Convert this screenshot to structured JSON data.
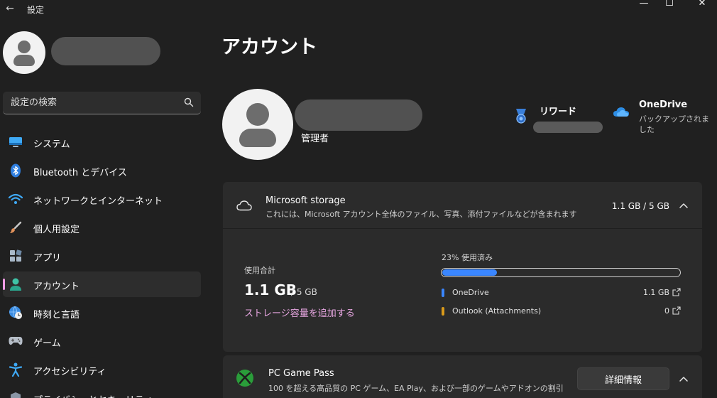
{
  "window": {
    "back_glyph": "←",
    "title": "設定",
    "min_glyph": "—",
    "max_glyph": "☐",
    "close_glyph": "✕"
  },
  "search": {
    "placeholder": "設定の検索"
  },
  "sidebar": {
    "items": [
      {
        "label": "システム",
        "icon": "monitor-icon",
        "active": false
      },
      {
        "label": "Bluetooth とデバイス",
        "icon": "bluetooth-icon",
        "active": false
      },
      {
        "label": "ネットワークとインターネット",
        "icon": "wifi-icon",
        "active": false
      },
      {
        "label": "個人用設定",
        "icon": "paintbrush-icon",
        "active": false
      },
      {
        "label": "アプリ",
        "icon": "apps-icon",
        "active": false
      },
      {
        "label": "アカウント",
        "icon": "person-icon",
        "active": true
      },
      {
        "label": "時刻と言語",
        "icon": "clock-globe-icon",
        "active": false
      },
      {
        "label": "ゲーム",
        "icon": "gamepad-icon",
        "active": false
      },
      {
        "label": "アクセシビリティ",
        "icon": "accessibility-icon",
        "active": false
      },
      {
        "label": "プライバシーとセキュリティ",
        "icon": "shield-icon",
        "active": false
      }
    ]
  },
  "main": {
    "title": "アカウント",
    "profile": {
      "role": "管理者"
    },
    "rewards": {
      "title": "リワード"
    },
    "onedrive": {
      "title": "OneDrive",
      "status": "バックアップされました"
    },
    "storage": {
      "title": "Microsoft storage",
      "description": "これには、Microsoft アカウント全体のファイル、写真、添付ファイルなどが含まれます",
      "summary": "1.1 GB / 5 GB",
      "usage_label": "使用合計",
      "used": "1.1 GB",
      "total": "/ 5 GB",
      "add_link": "ストレージ容量を追加する",
      "percent_label": "23% 使用済み",
      "percent_value": 23,
      "services": [
        {
          "name": "OneDrive",
          "value": "1.1 GB",
          "color": "#3a86ff"
        },
        {
          "name": "Outlook (Attachments)",
          "value": "0",
          "color": "#d99a1a"
        }
      ]
    },
    "gamepass": {
      "title": "PC Game Pass",
      "description": "100 を超える高品質の PC ゲーム、EA Play、および一部のゲームやアドオンの割引",
      "button": "詳細情報"
    }
  },
  "colors": {
    "accent": "#f39de6",
    "link": "#e7a6e1",
    "progress": "#3a86ff",
    "background": "#202020",
    "card": "#2b2b2b"
  }
}
